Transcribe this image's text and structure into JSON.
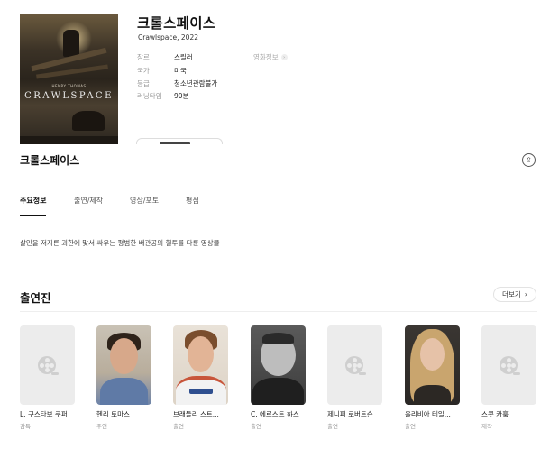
{
  "movie": {
    "title": "크롤스페이스",
    "subtitle": "Crawlspace, 2022",
    "poster": {
      "actor_text": "HENRY THOMAS",
      "title_text": "CRAWLSPACE"
    },
    "info": [
      {
        "label": "장르",
        "value": "스릴러"
      },
      {
        "label": "국가",
        "value": "미국"
      },
      {
        "label": "등급",
        "value": "청소년관람불가"
      },
      {
        "label": "러닝타임",
        "value": "90분"
      }
    ],
    "info_link": "영화정보"
  },
  "section": {
    "title": "크롤스페이스"
  },
  "tabs": [
    "주요정보",
    "출연/제작",
    "영상/포토",
    "평점"
  ],
  "active_tab": 0,
  "synopsis": "살인을 저지른 괴한에 맞서 싸우는 평범한 배관공의 혈투를 다룬 영상물",
  "cast": {
    "heading": "출연진",
    "more_label": "더보기",
    "members": [
      {
        "name": "L. 구스타보 쿠퍼",
        "role": "감독",
        "photo": "placeholder"
      },
      {
        "name": "헨리 토마스",
        "role": "주연",
        "photo": "man-dark-hair"
      },
      {
        "name": "브래들리 스트...",
        "role": "출연",
        "photo": "man-brown-hair"
      },
      {
        "name": "C. 에르스트 하스",
        "role": "출연",
        "photo": "man-bw"
      },
      {
        "name": "제니퍼 로버트슨",
        "role": "출연",
        "photo": "placeholder"
      },
      {
        "name": "올리비아 테일...",
        "role": "출연",
        "photo": "woman-blonde"
      },
      {
        "name": "스콧 카훌",
        "role": "제작",
        "photo": "placeholder"
      }
    ]
  },
  "colors": {
    "text": "#222222",
    "muted": "#999999",
    "placeholder": "#ececec",
    "divider": "#e4e4e4"
  }
}
